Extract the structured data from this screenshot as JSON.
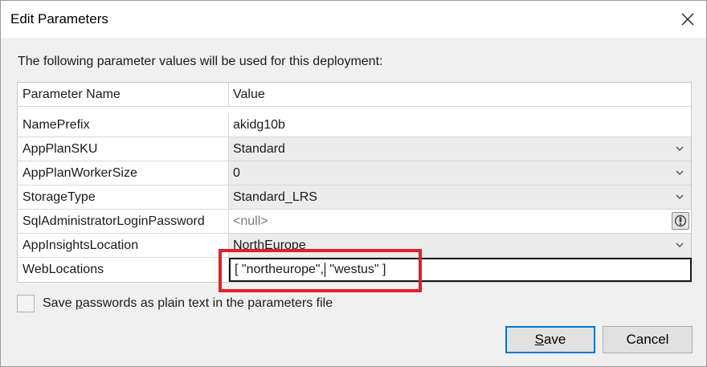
{
  "window": {
    "title": "Edit Parameters"
  },
  "description": "The following parameter values will be used for this deployment:",
  "grid": {
    "headers": {
      "name": "Parameter Name",
      "value": "Value"
    },
    "rows": [
      {
        "name": "NamePrefix",
        "value": "akidg10b"
      },
      {
        "name": "AppPlanSKU",
        "value": "Standard"
      },
      {
        "name": "AppPlanWorkerSize",
        "value": "0"
      },
      {
        "name": "StorageType",
        "value": "Standard_LRS"
      },
      {
        "name": "SqlAdministratorLoginPassword",
        "value": "<null>"
      },
      {
        "name": "AppInsightsLocation",
        "value": "NorthEurope"
      },
      {
        "name": "WebLocations",
        "value_before_caret": "[ \"northeurope\",",
        "value_after_caret": " \"westus\" ]"
      }
    ]
  },
  "save_passwords": {
    "label_pre": "Save ",
    "label_underlined": "p",
    "label_post": "asswords as plain text in the parameters file",
    "checked": false
  },
  "buttons": {
    "save_underlined": "S",
    "save_rest": "ave",
    "cancel": "Cancel"
  },
  "colors": {
    "highlight": "#e0202a",
    "focus_border": "#0078d7"
  }
}
